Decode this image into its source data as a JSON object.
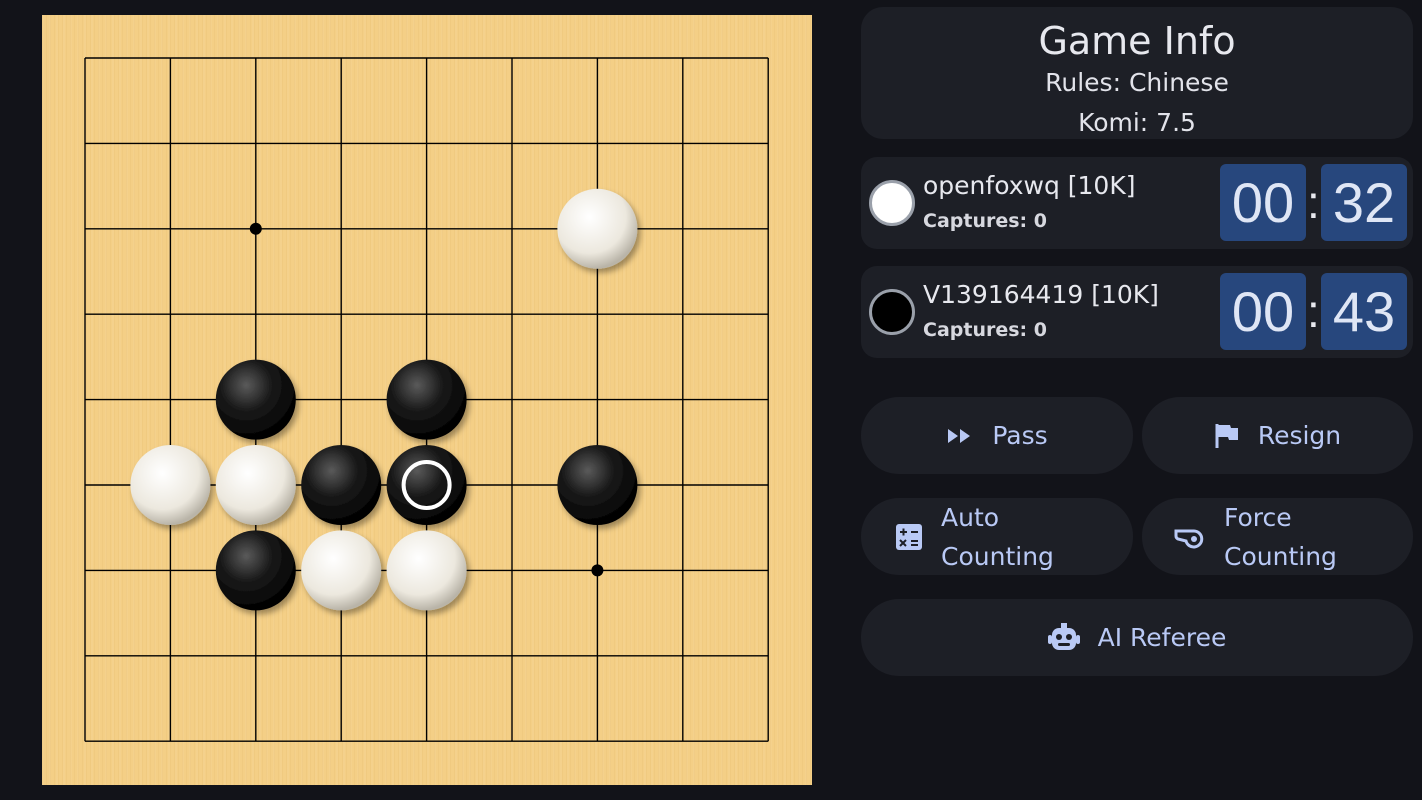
{
  "board": {
    "size": 9,
    "star_points": [
      [
        2,
        2
      ],
      [
        6,
        6
      ]
    ],
    "stones": [
      {
        "color": "white",
        "col": 6,
        "row": 2
      },
      {
        "color": "black",
        "col": 2,
        "row": 4
      },
      {
        "color": "black",
        "col": 4,
        "row": 4
      },
      {
        "color": "white",
        "col": 1,
        "row": 5
      },
      {
        "color": "white",
        "col": 2,
        "row": 5
      },
      {
        "color": "black",
        "col": 3,
        "row": 5
      },
      {
        "color": "black",
        "col": 4,
        "row": 5,
        "last_move": true
      },
      {
        "color": "black",
        "col": 6,
        "row": 5
      },
      {
        "color": "black",
        "col": 2,
        "row": 6
      },
      {
        "color": "white",
        "col": 3,
        "row": 6
      },
      {
        "color": "white",
        "col": 4,
        "row": 6
      }
    ]
  },
  "game_info": {
    "title": "Game Info",
    "rules": "Rules: Chinese",
    "komi": "Komi: 7.5"
  },
  "players": [
    {
      "stone": "white",
      "name": "openfoxwq [10K]",
      "captures": "Captures: 0",
      "clock_min": "00",
      "clock_sec": "32"
    },
    {
      "stone": "black",
      "name": "V139164419 [10K]",
      "captures": "Captures: 0",
      "clock_min": "00",
      "clock_sec": "43"
    }
  ],
  "clock_separator": ":",
  "buttons": {
    "pass": "Pass",
    "resign": "Resign",
    "auto_counting_line1": "Auto",
    "auto_counting_line2": "Counting",
    "force_counting_line1": "Force",
    "force_counting_line2": "Counting",
    "ai_referee": "AI Referee"
  },
  "colors": {
    "board": "#f4cf86",
    "panel": "#1d1f26",
    "clock_bg": "#27477d",
    "accent_text": "#b9c9f5"
  }
}
